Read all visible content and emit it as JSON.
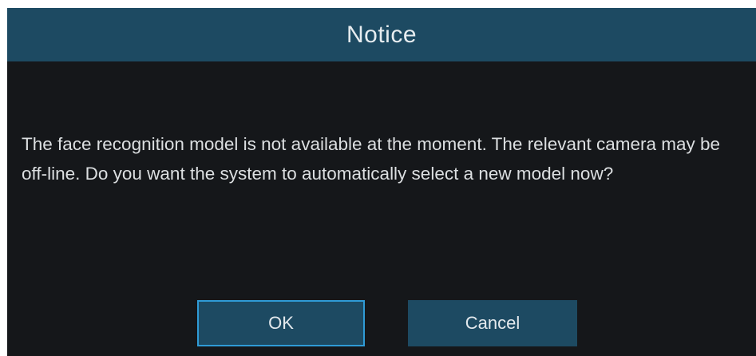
{
  "dialog": {
    "title": "Notice",
    "message": "The face recognition model is not available at the moment. The relevant camera may be off-line. Do you want the system to automatically select a new model now?",
    "buttons": {
      "ok_label": "OK",
      "cancel_label": "Cancel"
    },
    "colors": {
      "title_bar": "#1d4a62",
      "background": "#15171a",
      "focus_border": "#2f9bd6",
      "text": "#dcdfe1"
    },
    "focused_button": "ok"
  }
}
